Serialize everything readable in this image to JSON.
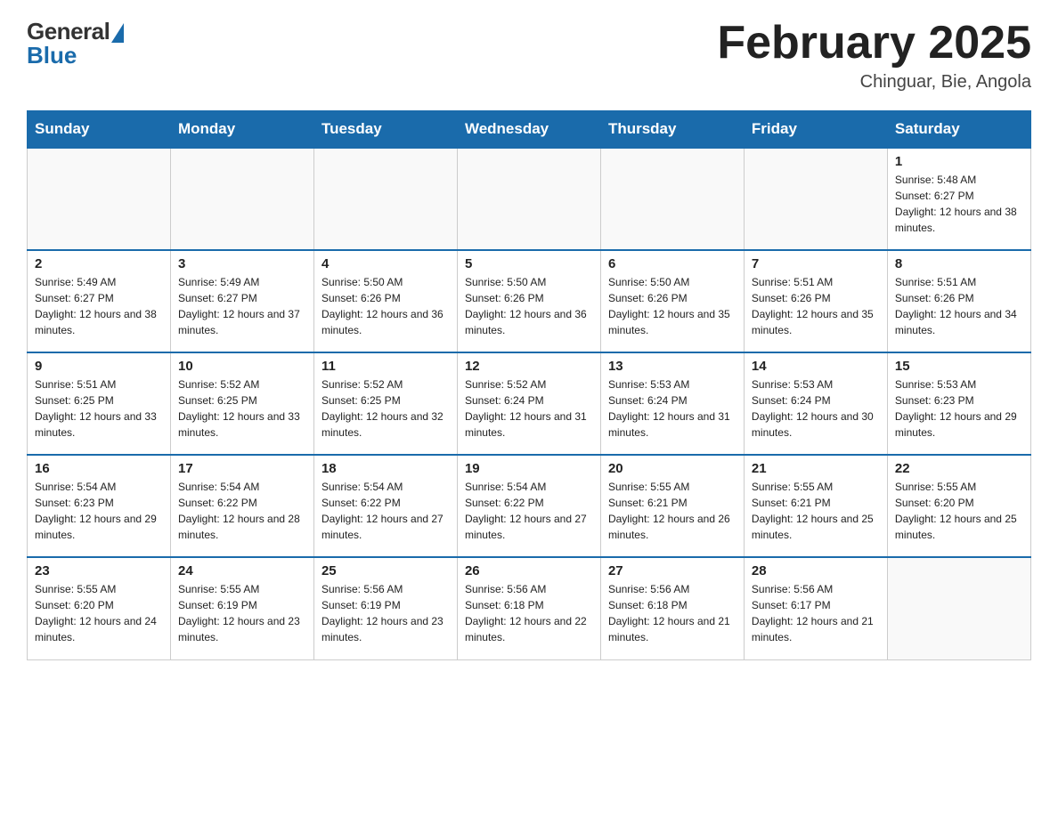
{
  "header": {
    "logo_general": "General",
    "logo_blue": "Blue",
    "month_title": "February 2025",
    "location": "Chinguar, Bie, Angola"
  },
  "days_of_week": [
    "Sunday",
    "Monday",
    "Tuesday",
    "Wednesday",
    "Thursday",
    "Friday",
    "Saturday"
  ],
  "weeks": [
    [
      {
        "day": "",
        "info": ""
      },
      {
        "day": "",
        "info": ""
      },
      {
        "day": "",
        "info": ""
      },
      {
        "day": "",
        "info": ""
      },
      {
        "day": "",
        "info": ""
      },
      {
        "day": "",
        "info": ""
      },
      {
        "day": "1",
        "info": "Sunrise: 5:48 AM\nSunset: 6:27 PM\nDaylight: 12 hours and 38 minutes."
      }
    ],
    [
      {
        "day": "2",
        "info": "Sunrise: 5:49 AM\nSunset: 6:27 PM\nDaylight: 12 hours and 38 minutes."
      },
      {
        "day": "3",
        "info": "Sunrise: 5:49 AM\nSunset: 6:27 PM\nDaylight: 12 hours and 37 minutes."
      },
      {
        "day": "4",
        "info": "Sunrise: 5:50 AM\nSunset: 6:26 PM\nDaylight: 12 hours and 36 minutes."
      },
      {
        "day": "5",
        "info": "Sunrise: 5:50 AM\nSunset: 6:26 PM\nDaylight: 12 hours and 36 minutes."
      },
      {
        "day": "6",
        "info": "Sunrise: 5:50 AM\nSunset: 6:26 PM\nDaylight: 12 hours and 35 minutes."
      },
      {
        "day": "7",
        "info": "Sunrise: 5:51 AM\nSunset: 6:26 PM\nDaylight: 12 hours and 35 minutes."
      },
      {
        "day": "8",
        "info": "Sunrise: 5:51 AM\nSunset: 6:26 PM\nDaylight: 12 hours and 34 minutes."
      }
    ],
    [
      {
        "day": "9",
        "info": "Sunrise: 5:51 AM\nSunset: 6:25 PM\nDaylight: 12 hours and 33 minutes."
      },
      {
        "day": "10",
        "info": "Sunrise: 5:52 AM\nSunset: 6:25 PM\nDaylight: 12 hours and 33 minutes."
      },
      {
        "day": "11",
        "info": "Sunrise: 5:52 AM\nSunset: 6:25 PM\nDaylight: 12 hours and 32 minutes."
      },
      {
        "day": "12",
        "info": "Sunrise: 5:52 AM\nSunset: 6:24 PM\nDaylight: 12 hours and 31 minutes."
      },
      {
        "day": "13",
        "info": "Sunrise: 5:53 AM\nSunset: 6:24 PM\nDaylight: 12 hours and 31 minutes."
      },
      {
        "day": "14",
        "info": "Sunrise: 5:53 AM\nSunset: 6:24 PM\nDaylight: 12 hours and 30 minutes."
      },
      {
        "day": "15",
        "info": "Sunrise: 5:53 AM\nSunset: 6:23 PM\nDaylight: 12 hours and 29 minutes."
      }
    ],
    [
      {
        "day": "16",
        "info": "Sunrise: 5:54 AM\nSunset: 6:23 PM\nDaylight: 12 hours and 29 minutes."
      },
      {
        "day": "17",
        "info": "Sunrise: 5:54 AM\nSunset: 6:22 PM\nDaylight: 12 hours and 28 minutes."
      },
      {
        "day": "18",
        "info": "Sunrise: 5:54 AM\nSunset: 6:22 PM\nDaylight: 12 hours and 27 minutes."
      },
      {
        "day": "19",
        "info": "Sunrise: 5:54 AM\nSunset: 6:22 PM\nDaylight: 12 hours and 27 minutes."
      },
      {
        "day": "20",
        "info": "Sunrise: 5:55 AM\nSunset: 6:21 PM\nDaylight: 12 hours and 26 minutes."
      },
      {
        "day": "21",
        "info": "Sunrise: 5:55 AM\nSunset: 6:21 PM\nDaylight: 12 hours and 25 minutes."
      },
      {
        "day": "22",
        "info": "Sunrise: 5:55 AM\nSunset: 6:20 PM\nDaylight: 12 hours and 25 minutes."
      }
    ],
    [
      {
        "day": "23",
        "info": "Sunrise: 5:55 AM\nSunset: 6:20 PM\nDaylight: 12 hours and 24 minutes."
      },
      {
        "day": "24",
        "info": "Sunrise: 5:55 AM\nSunset: 6:19 PM\nDaylight: 12 hours and 23 minutes."
      },
      {
        "day": "25",
        "info": "Sunrise: 5:56 AM\nSunset: 6:19 PM\nDaylight: 12 hours and 23 minutes."
      },
      {
        "day": "26",
        "info": "Sunrise: 5:56 AM\nSunset: 6:18 PM\nDaylight: 12 hours and 22 minutes."
      },
      {
        "day": "27",
        "info": "Sunrise: 5:56 AM\nSunset: 6:18 PM\nDaylight: 12 hours and 21 minutes."
      },
      {
        "day": "28",
        "info": "Sunrise: 5:56 AM\nSunset: 6:17 PM\nDaylight: 12 hours and 21 minutes."
      },
      {
        "day": "",
        "info": ""
      }
    ]
  ]
}
